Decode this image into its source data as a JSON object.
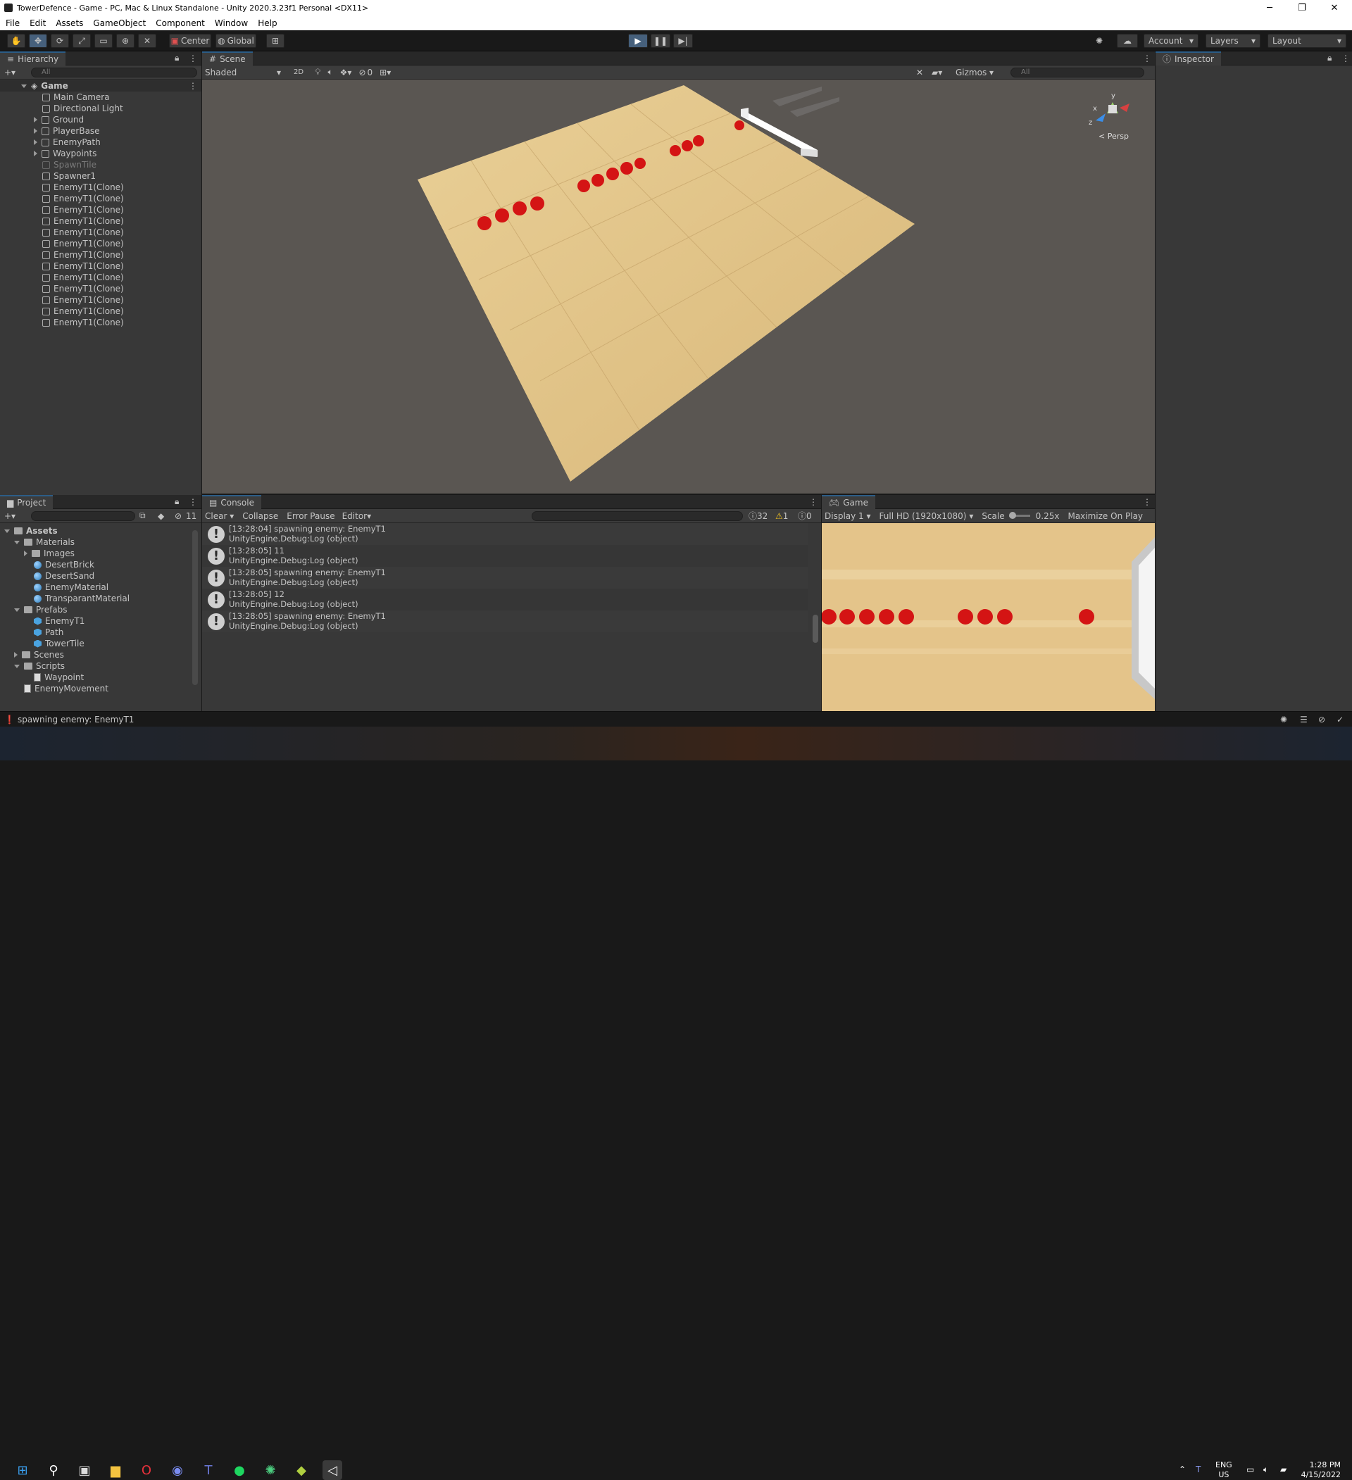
{
  "window": {
    "title": "TowerDefence - Game - PC, Mac & Linux Standalone - Unity 2020.3.23f1 Personal <DX11>",
    "minimize": "─",
    "restore": "❐",
    "close": "✕"
  },
  "menu": [
    "File",
    "Edit",
    "Assets",
    "GameObject",
    "Component",
    "Window",
    "Help"
  ],
  "toolbar": {
    "pivot": "Center",
    "space": "Global",
    "account": "Account",
    "layers": "Layers",
    "layout": "Layout"
  },
  "hierarchy": {
    "tab": "Hierarchy",
    "search_placeholder": "All",
    "scene": "Game",
    "items": [
      {
        "label": "Main Camera",
        "arrow": false,
        "dim": false
      },
      {
        "label": "Directional Light",
        "arrow": false,
        "dim": false
      },
      {
        "label": "Ground",
        "arrow": true,
        "dim": false
      },
      {
        "label": "PlayerBase",
        "arrow": true,
        "dim": false
      },
      {
        "label": "EnemyPath",
        "arrow": true,
        "dim": false
      },
      {
        "label": "Waypoints",
        "arrow": true,
        "dim": false
      },
      {
        "label": "SpawnTile",
        "arrow": false,
        "dim": true
      },
      {
        "label": "Spawner1",
        "arrow": false,
        "dim": false
      },
      {
        "label": "EnemyT1(Clone)",
        "arrow": false,
        "dim": false
      },
      {
        "label": "EnemyT1(Clone)",
        "arrow": false,
        "dim": false
      },
      {
        "label": "EnemyT1(Clone)",
        "arrow": false,
        "dim": false
      },
      {
        "label": "EnemyT1(Clone)",
        "arrow": false,
        "dim": false
      },
      {
        "label": "EnemyT1(Clone)",
        "arrow": false,
        "dim": false
      },
      {
        "label": "EnemyT1(Clone)",
        "arrow": false,
        "dim": false
      },
      {
        "label": "EnemyT1(Clone)",
        "arrow": false,
        "dim": false
      },
      {
        "label": "EnemyT1(Clone)",
        "arrow": false,
        "dim": false
      },
      {
        "label": "EnemyT1(Clone)",
        "arrow": false,
        "dim": false
      },
      {
        "label": "EnemyT1(Clone)",
        "arrow": false,
        "dim": false
      },
      {
        "label": "EnemyT1(Clone)",
        "arrow": false,
        "dim": false
      },
      {
        "label": "EnemyT1(Clone)",
        "arrow": false,
        "dim": false
      },
      {
        "label": "EnemyT1(Clone)",
        "arrow": false,
        "dim": false
      }
    ]
  },
  "scene": {
    "tab": "Scene",
    "shading": "Shaded",
    "mode2d": "2D",
    "hidden_count": "0",
    "gizmos": "Gizmos",
    "search_placeholder": "All",
    "persp": "< Persp",
    "axis_y": "y",
    "axis_x": "x",
    "axis_z": "z"
  },
  "inspector": {
    "tab": "Inspector"
  },
  "project": {
    "tab": "Project",
    "hidden_count": "11",
    "root": "Assets",
    "items": [
      {
        "label": "Materials",
        "kind": "folder",
        "indent": 1,
        "arrow": "down"
      },
      {
        "label": "Images",
        "kind": "folder",
        "indent": 2,
        "arrow": "right"
      },
      {
        "label": "DesertBrick",
        "kind": "material",
        "indent": 2,
        "arrow": "none"
      },
      {
        "label": "DesertSand",
        "kind": "material",
        "indent": 2,
        "arrow": "none"
      },
      {
        "label": "EnemyMaterial",
        "kind": "material",
        "indent": 2,
        "arrow": "none"
      },
      {
        "label": "TransparantMaterial",
        "kind": "material",
        "indent": 2,
        "arrow": "none"
      },
      {
        "label": "Prefabs",
        "kind": "folder",
        "indent": 1,
        "arrow": "down"
      },
      {
        "label": "EnemyT1",
        "kind": "prefab",
        "indent": 2,
        "arrow": "none"
      },
      {
        "label": "Path",
        "kind": "prefab",
        "indent": 2,
        "arrow": "none"
      },
      {
        "label": "TowerTile",
        "kind": "prefab",
        "indent": 2,
        "arrow": "none"
      },
      {
        "label": "Scenes",
        "kind": "folder",
        "indent": 1,
        "arrow": "right"
      },
      {
        "label": "Scripts",
        "kind": "folder",
        "indent": 1,
        "arrow": "down"
      },
      {
        "label": "Waypoint",
        "kind": "script",
        "indent": 2,
        "arrow": "none"
      },
      {
        "label": "EnemyMovement",
        "kind": "script",
        "indent": 1,
        "arrow": "none"
      }
    ]
  },
  "console": {
    "tab": "Console",
    "clear": "Clear",
    "collapse": "Collapse",
    "error_pause": "Error Pause",
    "editor": "Editor",
    "log_count": "32",
    "warn_count": "1",
    "error_count": "0",
    "entries": [
      {
        "line1": "[13:28:04] spawning enemy: EnemyT1",
        "line2": "UnityEngine.Debug:Log (object)"
      },
      {
        "line1": "[13:28:05] 11",
        "line2": "UnityEngine.Debug:Log (object)"
      },
      {
        "line1": "[13:28:05] spawning enemy: EnemyT1",
        "line2": "UnityEngine.Debug:Log (object)"
      },
      {
        "line1": "[13:28:05] 12",
        "line2": "UnityEngine.Debug:Log (object)"
      },
      {
        "line1": "[13:28:05] spawning enemy: EnemyT1",
        "line2": "UnityEngine.Debug:Log (object)"
      }
    ]
  },
  "game": {
    "tab": "Game",
    "display": "Display 1",
    "resolution": "Full HD (1920x1080)",
    "scale_label": "Scale",
    "scale_value": "0.25x",
    "maximize": "Maximize On Play"
  },
  "status": {
    "message": "spawning enemy: EnemyT1"
  },
  "taskbar": {
    "lang": "ENG",
    "region": "US",
    "time": "1:28 PM",
    "date": "4/15/2022"
  },
  "colors": {
    "accent": "#2c5d87",
    "enemy": "#d41414",
    "sand": "#e8c88c",
    "scene_bg": "#5a5652"
  }
}
